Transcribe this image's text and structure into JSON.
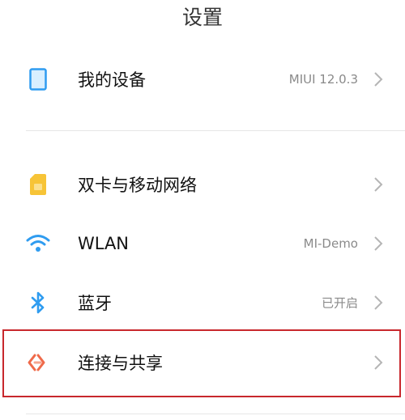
{
  "header": {
    "title": "设置"
  },
  "items": [
    {
      "id": "my-device",
      "label": "我的设备",
      "value": "MIUI 12.0.3",
      "icon": "tablet-icon",
      "icon_color": "#2f9cf0"
    },
    {
      "id": "sim-network",
      "label": "双卡与移动网络",
      "value": "",
      "icon": "sim-card-icon",
      "icon_color": "#f7c437"
    },
    {
      "id": "wlan",
      "label": "WLAN",
      "value": "MI-Demo",
      "icon": "wifi-icon",
      "icon_color": "#2f9cf0"
    },
    {
      "id": "bluetooth",
      "label": "蓝牙",
      "value": "已开启",
      "icon": "bluetooth-icon",
      "icon_color": "#2f9cf0"
    },
    {
      "id": "connection-sharing",
      "label": "连接与共享",
      "value": "",
      "icon": "connection-share-icon",
      "icon_color": "#ef6a4a"
    }
  ],
  "highlight_color": "#c8282d"
}
